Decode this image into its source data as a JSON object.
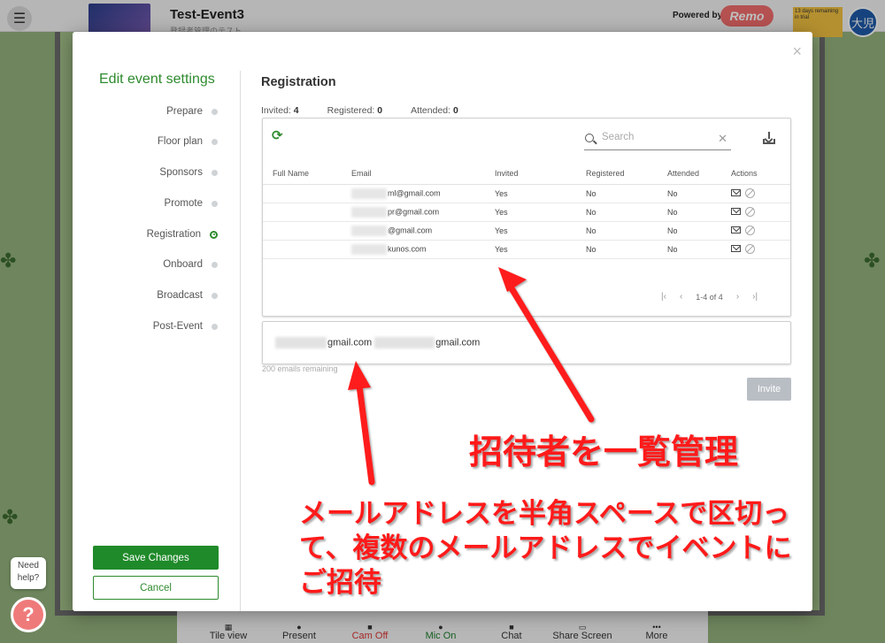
{
  "app": {
    "event_title": "Test-Event3",
    "event_subtitle": "登録者管理のテスト",
    "powered_by": "Powered by",
    "brand": "Remo",
    "trial_note": "13 days remaining in trial",
    "avatar_initials": "大児"
  },
  "bottom_bar": [
    {
      "label": "Tile view"
    },
    {
      "label": "Present"
    },
    {
      "label": "Cam Off"
    },
    {
      "label": "Mic On"
    },
    {
      "label": "Chat"
    },
    {
      "label": "Share Screen"
    },
    {
      "label": "More"
    }
  ],
  "help": {
    "bubble": "Need help?",
    "icon": "?"
  },
  "modal": {
    "side_title": "Edit event settings",
    "nav": [
      {
        "label": "Prepare"
      },
      {
        "label": "Floor plan"
      },
      {
        "label": "Sponsors"
      },
      {
        "label": "Promote"
      },
      {
        "label": "Registration"
      },
      {
        "label": "Onboard"
      },
      {
        "label": "Broadcast"
      },
      {
        "label": "Post-Event"
      }
    ],
    "save_label": "Save Changes",
    "cancel_label": "Cancel",
    "close": "×"
  },
  "registration": {
    "title": "Registration",
    "invited_label": "Invited:",
    "invited_count": "4",
    "registered_label": "Registered:",
    "registered_count": "0",
    "attended_label": "Attended:",
    "attended_count": "0",
    "search_placeholder": "Search",
    "columns": [
      "Full Name",
      "Email",
      "Invited",
      "Registered",
      "Attended",
      "Actions"
    ],
    "rows": [
      {
        "name": "",
        "email_visible": "ml@gmail.com",
        "invited": "Yes",
        "registered": "No",
        "attended": "No"
      },
      {
        "name": "",
        "email_visible": "pr@gmail.com",
        "invited": "Yes",
        "registered": "No",
        "attended": "No"
      },
      {
        "name": "",
        "email_visible": "@gmail.com",
        "invited": "Yes",
        "registered": "No",
        "attended": "No"
      },
      {
        "name": "",
        "email_visible": "kunos.com",
        "invited": "Yes",
        "registered": "No",
        "attended": "No"
      }
    ],
    "pagination": "1-4 of 4",
    "invite_emails": [
      "gmail.com",
      "gmail.com"
    ],
    "remaining": "200 emails remaining",
    "invite_label": "Invite"
  },
  "annotations": {
    "list_note": "招待者を一覧管理",
    "email_note": "メールアドレスを半角スペースで区切って、複数のメールアドレスでイベントにご招待",
    "arrow_color": "#ff1a1a"
  }
}
